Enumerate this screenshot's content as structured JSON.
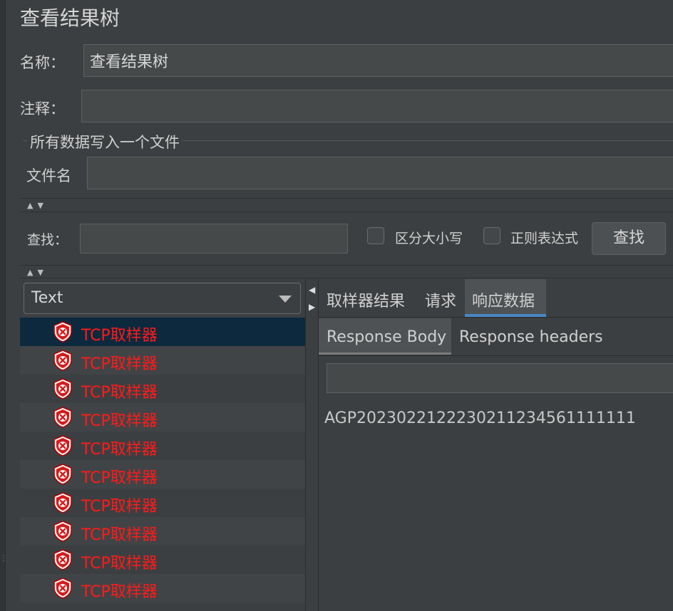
{
  "panel": {
    "title": "查看结果树"
  },
  "name_field": {
    "label": "名称：",
    "value": "查看结果树"
  },
  "comment_field": {
    "label": "注释：",
    "value": ""
  },
  "file_group": {
    "legend": "所有数据写入一个文件",
    "label": "文件名",
    "value": ""
  },
  "search": {
    "label": "查找：",
    "value": "",
    "case_sensitive_label": "区分大小写",
    "regex_label": "正则表达式",
    "button_label": "查找"
  },
  "renderer": {
    "selected": "Text"
  },
  "results": {
    "items": [
      {
        "label": "TCP取样器",
        "status": "error"
      },
      {
        "label": "TCP取样器",
        "status": "error"
      },
      {
        "label": "TCP取样器",
        "status": "error"
      },
      {
        "label": "TCP取样器",
        "status": "error"
      },
      {
        "label": "TCP取样器",
        "status": "error"
      },
      {
        "label": "TCP取样器",
        "status": "error"
      },
      {
        "label": "TCP取样器",
        "status": "error"
      },
      {
        "label": "TCP取样器",
        "status": "error"
      },
      {
        "label": "TCP取样器",
        "status": "error"
      },
      {
        "label": "TCP取样器",
        "status": "error"
      }
    ]
  },
  "tabs": [
    {
      "label": "取样器结果",
      "active": false
    },
    {
      "label": "请求",
      "active": false
    },
    {
      "label": "响应数据",
      "active": true
    }
  ],
  "subtabs": [
    {
      "label": "Response Body",
      "active": true
    },
    {
      "label": "Response headers",
      "active": false
    }
  ],
  "response": {
    "search_value": "",
    "body": "AGP2023022122230211234561111111"
  },
  "colors": {
    "error_text": "#ff1a1a",
    "tab_accent": "#4a88c7",
    "selection": "#0d293e",
    "background": "#3c3f41"
  },
  "icons": {
    "sampler_status": "error-shield-icon",
    "renderer_dropdown": "chevron-down-icon"
  }
}
